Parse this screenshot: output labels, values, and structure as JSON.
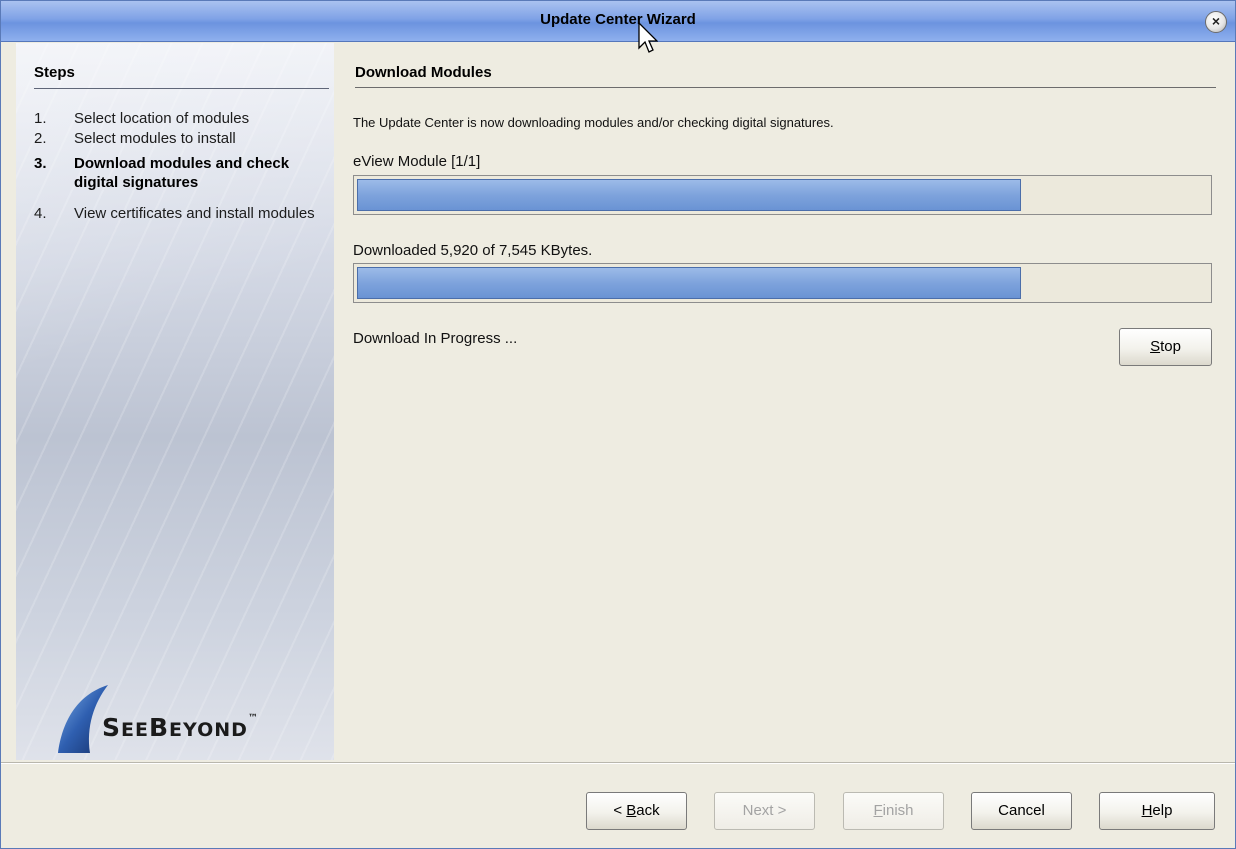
{
  "window": {
    "title": "Update Center Wizard",
    "close_label": "×"
  },
  "steps": {
    "heading": "Steps",
    "items": [
      {
        "num": "1.",
        "text": "Select location of modules"
      },
      {
        "num": "2.",
        "text": "Select modules to install"
      },
      {
        "num": "3.",
        "text": "Download modules and check digital signatures"
      },
      {
        "num": "4.",
        "text": "View certificates and install modules"
      }
    ],
    "active_index": 2
  },
  "logo": {
    "text_big1": "S",
    "text_small1": "EE",
    "text_big2": "B",
    "text_small2": "EYOND",
    "tm": "™"
  },
  "main": {
    "heading": "Download Modules",
    "description": "The Update Center is now downloading modules and/or checking digital signatures.",
    "module_label": "eView Module [1/1]",
    "module_progress": 0.78,
    "downloaded_label": "Downloaded 5,920 of 7,545 KBytes.",
    "download_progress": 0.78,
    "status": "Download In Progress ...",
    "stop_button": {
      "mnemonic": "S",
      "rest": "top"
    }
  },
  "footer": {
    "back": {
      "prefix": "< ",
      "mnemonic": "B",
      "rest": "ack"
    },
    "next": "Next >",
    "finish": {
      "mnemonic": "F",
      "rest": "inish"
    },
    "cancel": "Cancel",
    "help": {
      "mnemonic": "H",
      "rest": "elp"
    }
  },
  "colors": {
    "progress_fill": "#7ea3dc",
    "titlebar": "#7fa2e6",
    "dialog_bg": "#eeece1"
  }
}
